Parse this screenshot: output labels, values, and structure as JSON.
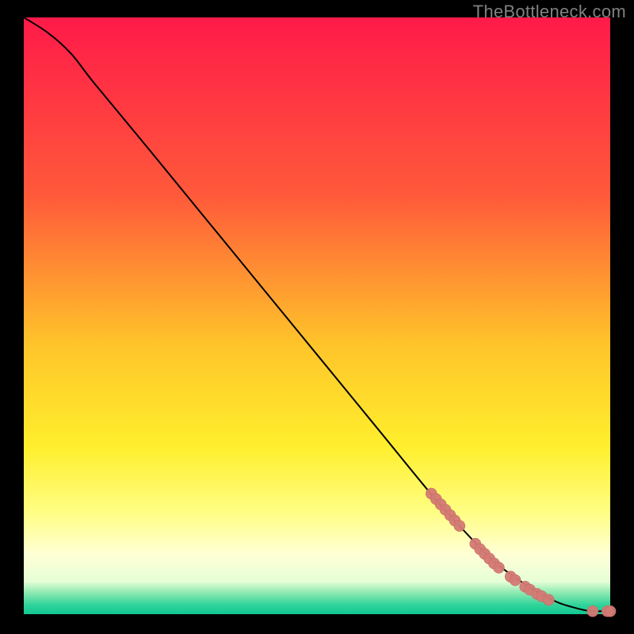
{
  "watermark": "TheBottleneck.com",
  "colors": {
    "curve": "#000000",
    "marker_fill": "#d37a74",
    "marker_stroke": "#c96a64",
    "background_black": "#000000",
    "watermark_text": "#808080"
  },
  "gradient_stops": [
    {
      "offset": 0.0,
      "color": "#ff1a49"
    },
    {
      "offset": 0.3,
      "color": "#ff5a3a"
    },
    {
      "offset": 0.55,
      "color": "#ffc52a"
    },
    {
      "offset": 0.72,
      "color": "#ffef2d"
    },
    {
      "offset": 0.83,
      "color": "#fffe84"
    },
    {
      "offset": 0.9,
      "color": "#ffffd6"
    },
    {
      "offset": 0.945,
      "color": "#e6ffd6"
    },
    {
      "offset": 0.965,
      "color": "#88e8b0"
    },
    {
      "offset": 0.985,
      "color": "#2ed39a"
    },
    {
      "offset": 1.0,
      "color": "#10c890"
    }
  ],
  "chart_data": {
    "type": "line",
    "title": "",
    "xlabel": "",
    "ylabel": "",
    "xlim": [
      0,
      100
    ],
    "ylim": [
      0,
      100
    ],
    "series": [
      {
        "name": "curve",
        "x": [
          0,
          4,
          8,
          12,
          20,
          30,
          40,
          50,
          60,
          70,
          76,
          80,
          84,
          88,
          91,
          93.5,
          95.5,
          97,
          99,
          100
        ],
        "y": [
          100,
          97.5,
          94,
          89,
          79.5,
          67.5,
          55.5,
          43.5,
          31.5,
          19.5,
          13,
          9,
          6,
          3.5,
          2,
          1.2,
          0.7,
          0.5,
          0.5,
          0.5
        ]
      }
    ],
    "markers": [
      {
        "x": 69.5,
        "y": 20.2
      },
      {
        "x": 70.3,
        "y": 19.3
      },
      {
        "x": 71.1,
        "y": 18.4
      },
      {
        "x": 71.9,
        "y": 17.5
      },
      {
        "x": 72.7,
        "y": 16.6
      },
      {
        "x": 73.5,
        "y": 15.7
      },
      {
        "x": 74.3,
        "y": 14.8
      },
      {
        "x": 77.0,
        "y": 11.8
      },
      {
        "x": 77.8,
        "y": 10.9
      },
      {
        "x": 78.6,
        "y": 10.1
      },
      {
        "x": 79.4,
        "y": 9.3
      },
      {
        "x": 80.2,
        "y": 8.5
      },
      {
        "x": 81.0,
        "y": 7.8
      },
      {
        "x": 83.0,
        "y": 6.3
      },
      {
        "x": 83.8,
        "y": 5.7
      },
      {
        "x": 85.5,
        "y": 4.6
      },
      {
        "x": 86.3,
        "y": 4.1
      },
      {
        "x": 87.5,
        "y": 3.4
      },
      {
        "x": 88.3,
        "y": 3.0
      },
      {
        "x": 89.5,
        "y": 2.4
      },
      {
        "x": 97.0,
        "y": 0.5
      },
      {
        "x": 99.5,
        "y": 0.5
      },
      {
        "x": 100.0,
        "y": 0.5
      }
    ],
    "marker_radius": 7
  }
}
